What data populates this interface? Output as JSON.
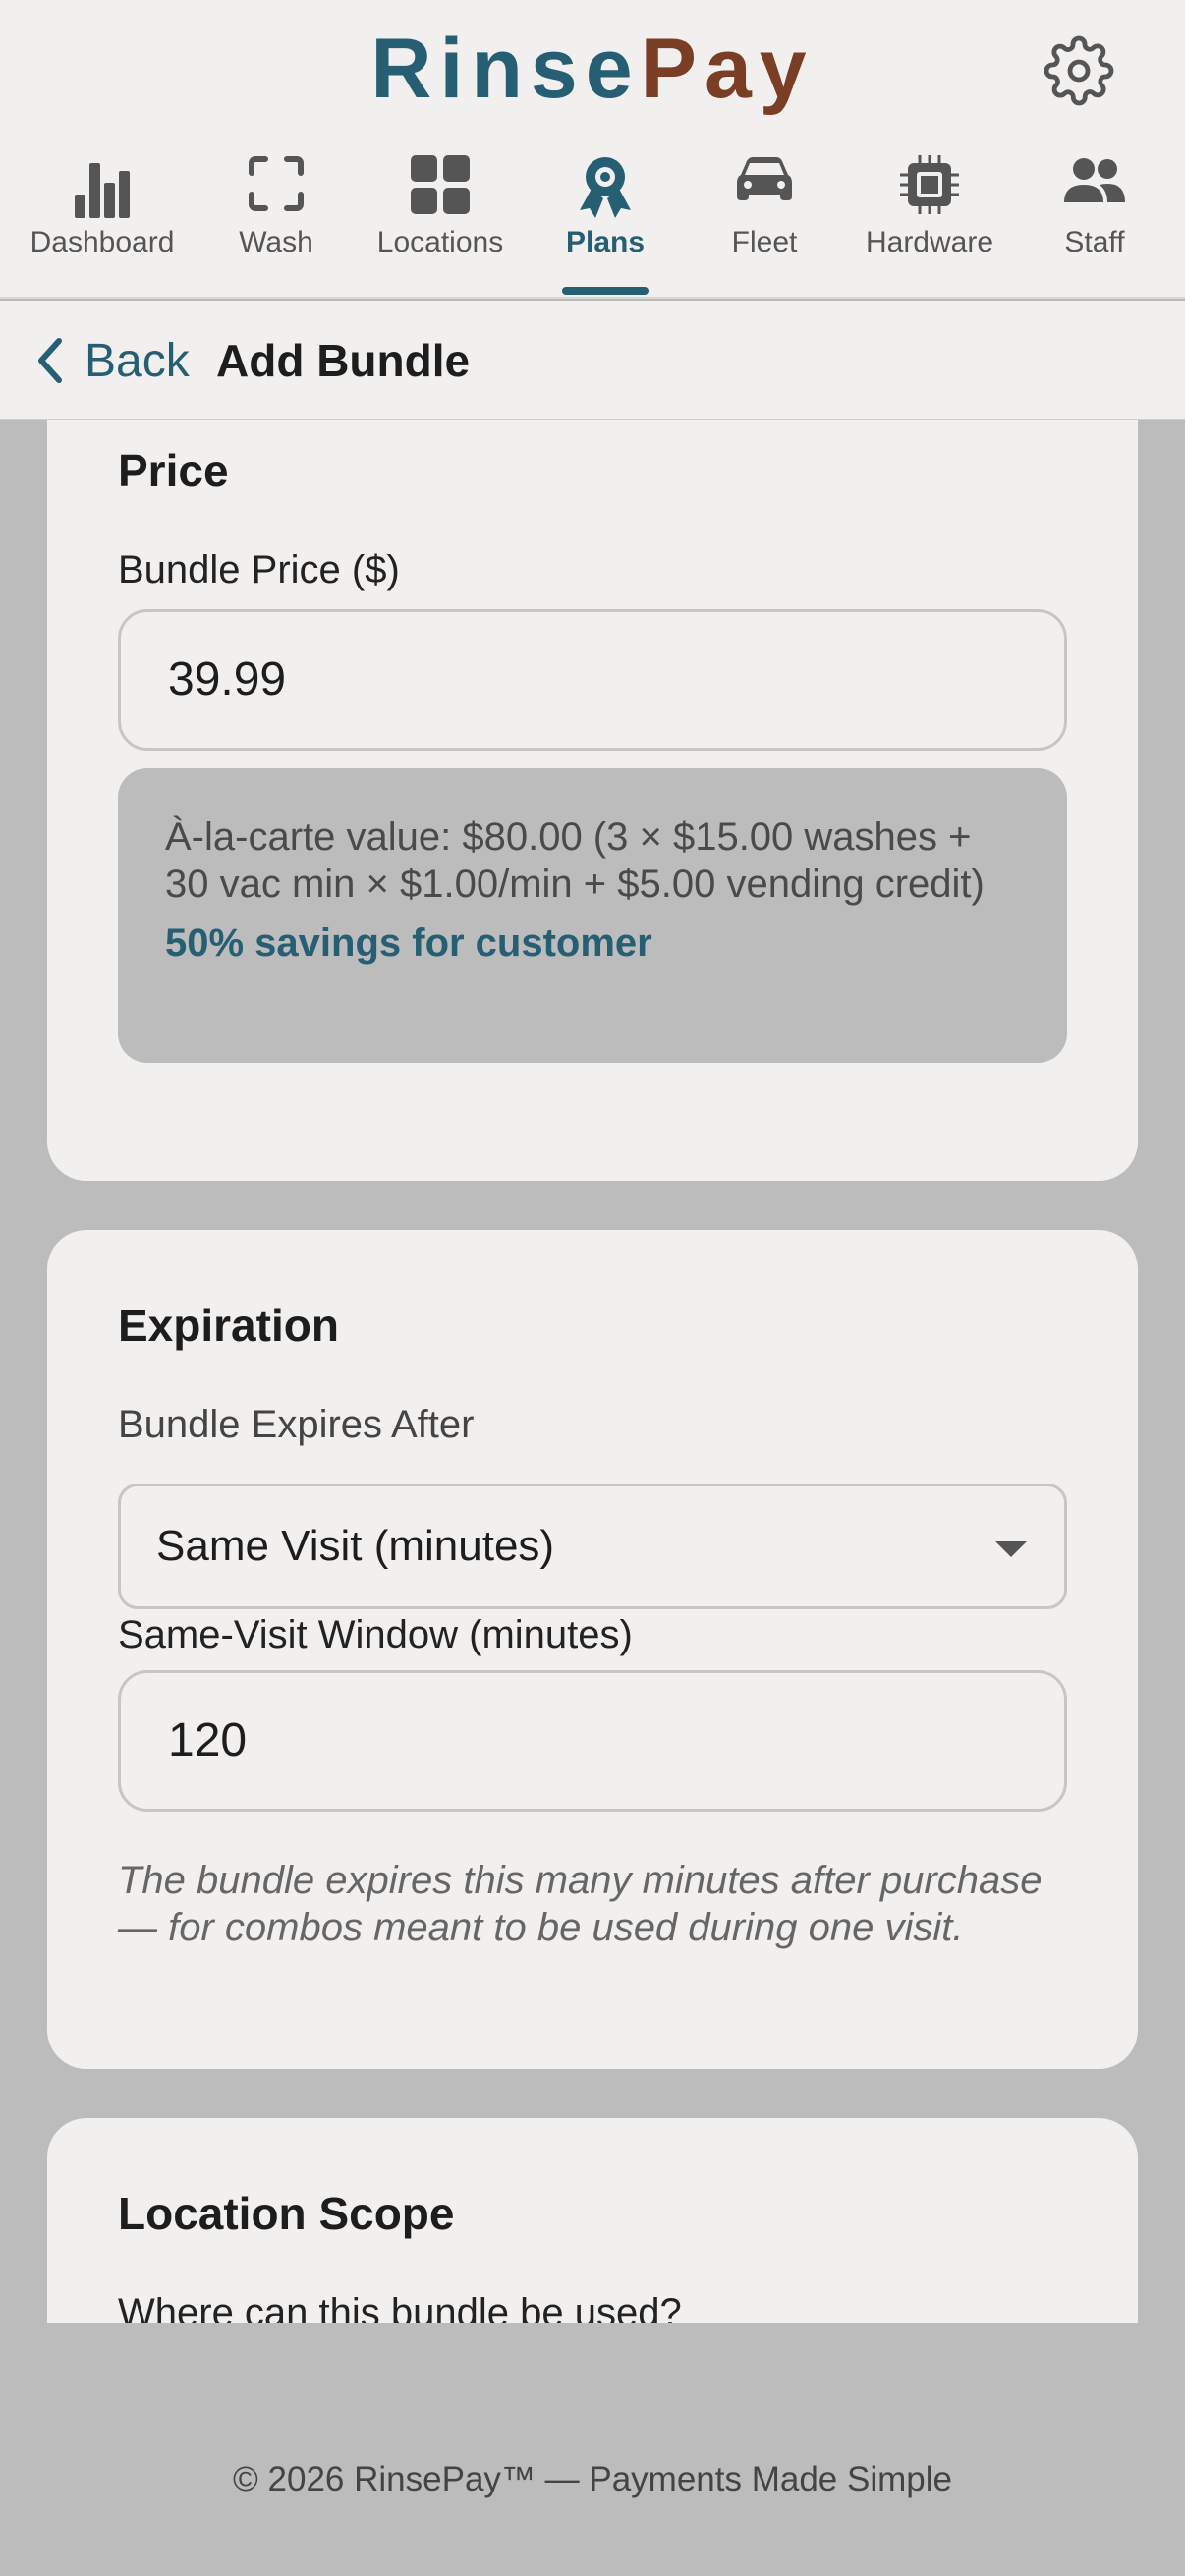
{
  "app": {
    "brand_part1": "Rinse",
    "brand_part2": "Pay"
  },
  "icons": {
    "settings": "gear-icon",
    "back": "chevron-left-icon"
  },
  "nav": {
    "items": [
      {
        "label": "Dashboard",
        "icon": "bar-chart-icon"
      },
      {
        "label": "Wash",
        "icon": "scan-frame-icon"
      },
      {
        "label": "Locations",
        "icon": "grid-icon"
      },
      {
        "label": "Plans",
        "icon": "award-ribbon-icon",
        "active": true
      },
      {
        "label": "Fleet",
        "icon": "car-icon"
      },
      {
        "label": "Hardware",
        "icon": "chip-icon"
      },
      {
        "label": "Staff",
        "icon": "users-icon"
      }
    ]
  },
  "subheader": {
    "back_label": "Back",
    "title": "Add Bundle"
  },
  "price": {
    "heading": "Price",
    "bundle_price_label": "Bundle Price ($)",
    "bundle_price_value": "39.99",
    "alacarte_text": "À-la-carte value: $80.00 (3 × $15.00 washes + 30 vac min × $1.00/min + $5.00 vending credit)",
    "savings_text": "50% savings for customer"
  },
  "expiration": {
    "heading": "Expiration",
    "expires_label": "Bundle Expires After",
    "expires_selected": "Same Visit (minutes)",
    "window_label": "Same-Visit Window (minutes)",
    "window_value": "120",
    "hint": "The bundle expires this many minutes after purchase — for combos meant to be used during one visit."
  },
  "scope": {
    "heading": "Location Scope",
    "question": "Where can this bundle be used?"
  },
  "footer": {
    "text": "© 2026 RinsePay™ — Payments Made Simple"
  },
  "colors": {
    "accent": "#265f73",
    "brand_secondary": "#7a3e25",
    "background": "#bbbcbb",
    "surface": "#f2f0ee"
  }
}
